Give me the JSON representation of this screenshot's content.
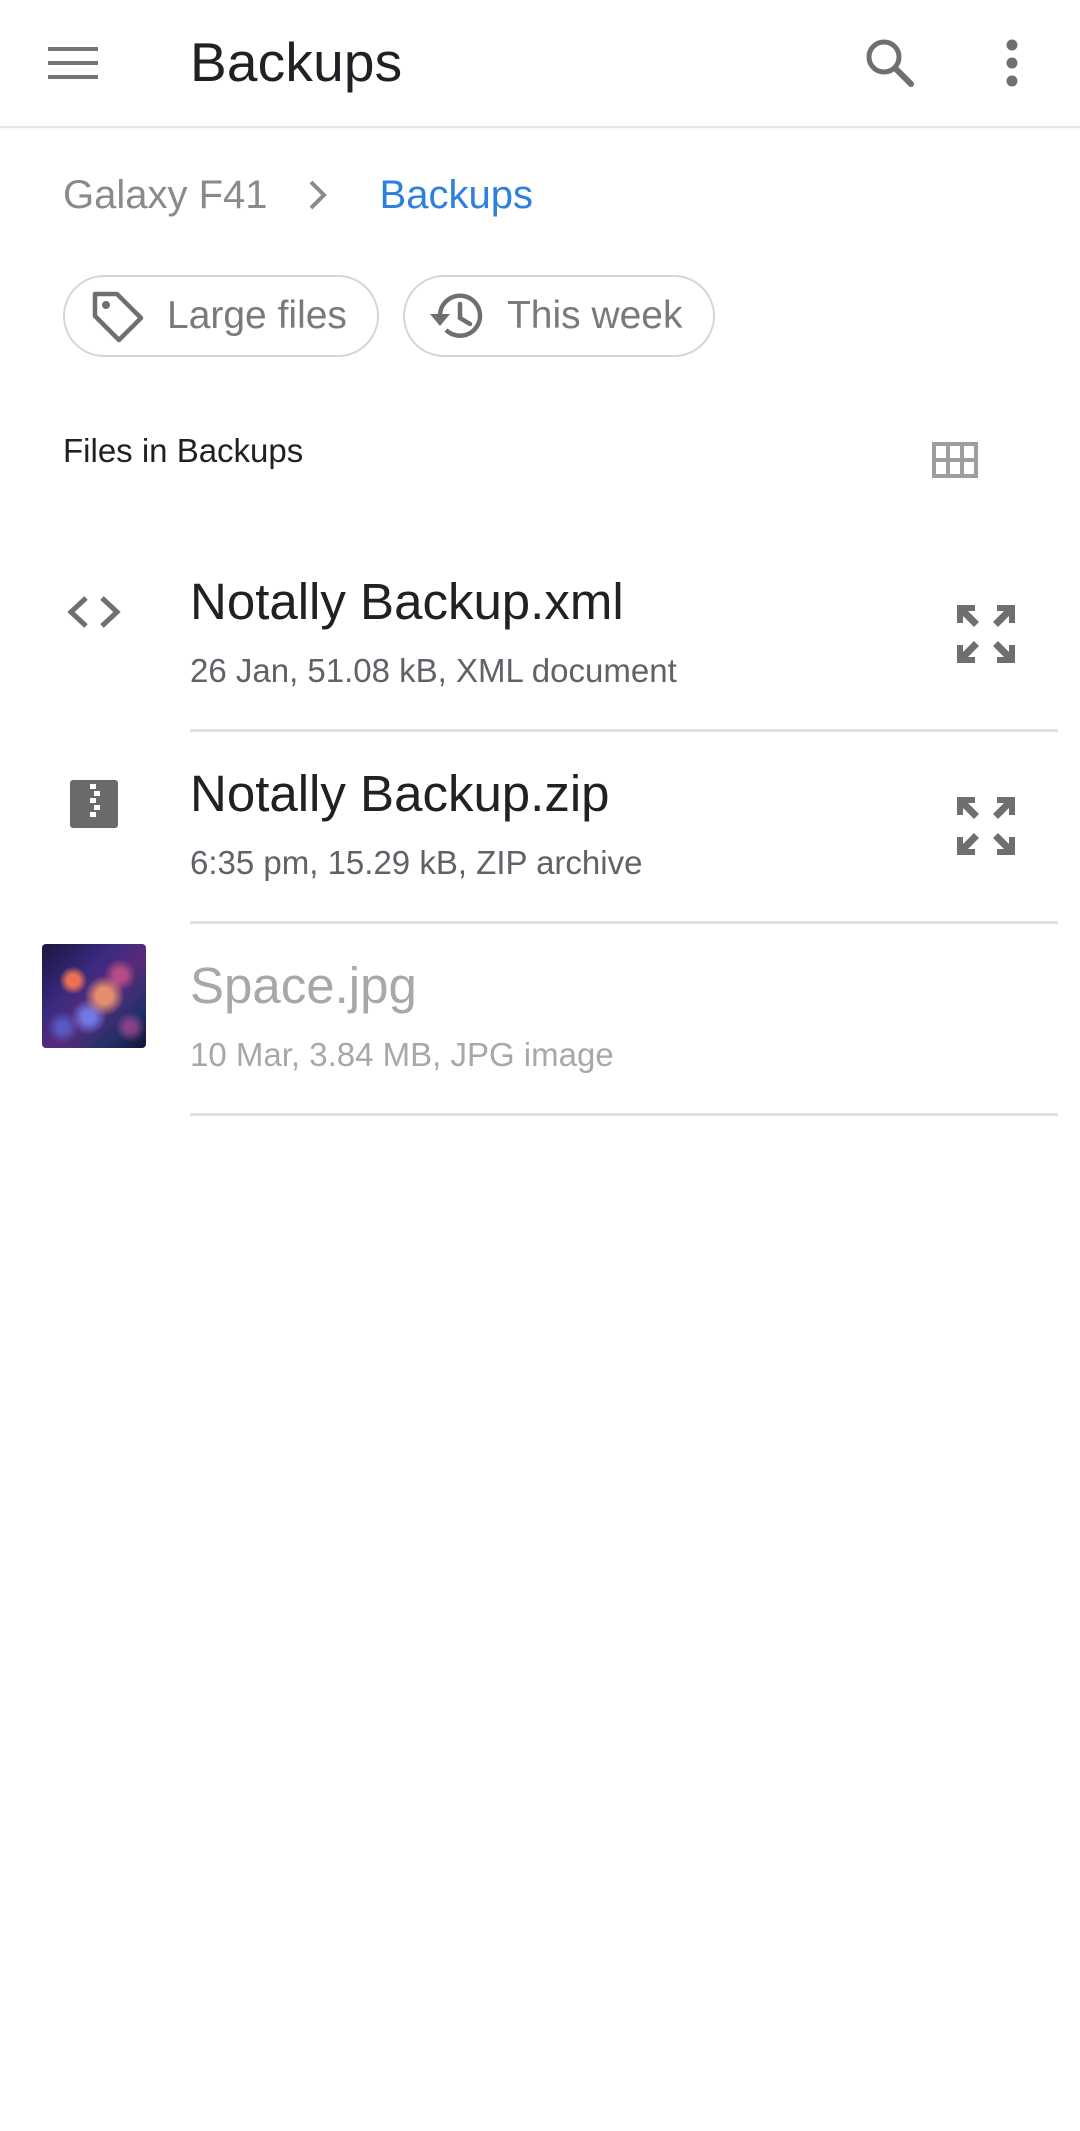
{
  "appbar": {
    "title": "Backups",
    "menu_icon": "menu-icon",
    "search_icon": "search-icon",
    "more_icon": "more-vert-icon"
  },
  "breadcrumb": {
    "root": "Galaxy F41",
    "separator_icon": "chevron-right-icon",
    "current": "Backups"
  },
  "chips": [
    {
      "label": "Large files",
      "icon": "tag-icon"
    },
    {
      "label": "This week",
      "icon": "history-icon"
    }
  ],
  "section": {
    "title": "Files in Backups",
    "view_toggle_icon": "grid-view-icon"
  },
  "files": [
    {
      "name": "Notally Backup.xml",
      "meta": "26 Jan, 51.08 kB, XML document",
      "icon": "code-icon",
      "action_icon": "expand-icon",
      "dimmed": false
    },
    {
      "name": "Notally Backup.zip",
      "meta": "6:35 pm, 15.29 kB, ZIP archive",
      "icon": "zip-icon",
      "action_icon": "expand-icon",
      "dimmed": false
    },
    {
      "name": "Space.jpg",
      "meta": "10 Mar, 3.84 MB, JPG image",
      "icon": "image-thumbnail",
      "dimmed": true
    }
  ],
  "colors": {
    "accent": "#2f80de",
    "icon_gray": "#6f6f6f",
    "divider": "#e0e0e0"
  }
}
